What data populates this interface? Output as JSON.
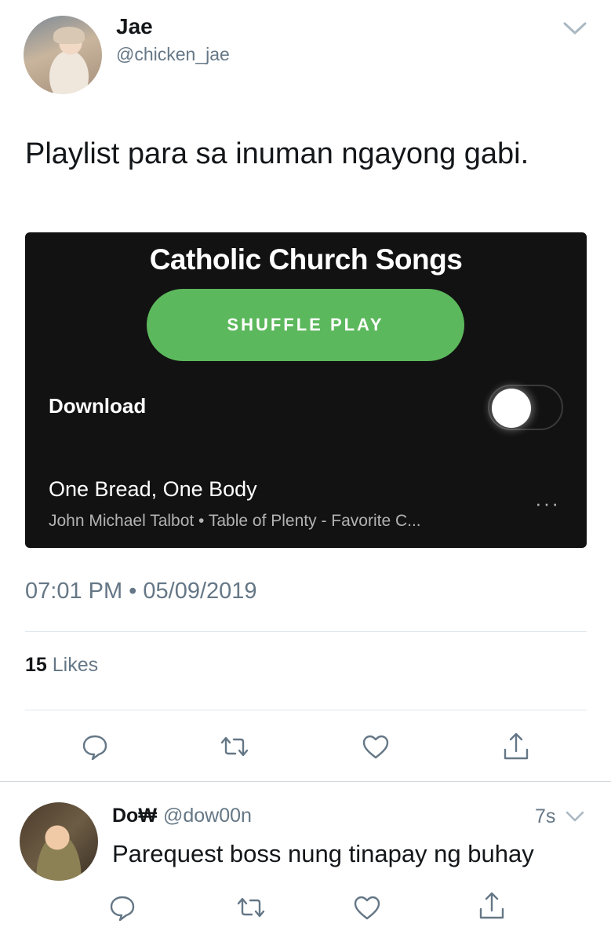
{
  "tweet": {
    "author_name": "Jae",
    "author_handle": "@chicken_jae",
    "text": "Playlist para sa inuman ngayong gabi.",
    "timestamp": "07:01 PM • 05/09/2019",
    "likes_count": "15",
    "likes_label": "Likes"
  },
  "media": {
    "playlist_title": "Catholic Church Songs",
    "shuffle_label": "SHUFFLE PLAY",
    "download_label": "Download",
    "download_enabled": false,
    "song_title": "One Bread, One Body",
    "song_subtitle": "John Michael Talbot • Table of Plenty - Favorite C...",
    "more_label": "···",
    "accent_color": "#5cb85c",
    "background_color": "#121212"
  },
  "actions": [
    "reply-icon",
    "retweet-icon",
    "like-icon",
    "share-icon"
  ],
  "reply": {
    "author_name": "Do₩",
    "author_handle": "@dow00n",
    "time": "7s",
    "text": "Parequest boss nung tinapay ng buhay"
  }
}
